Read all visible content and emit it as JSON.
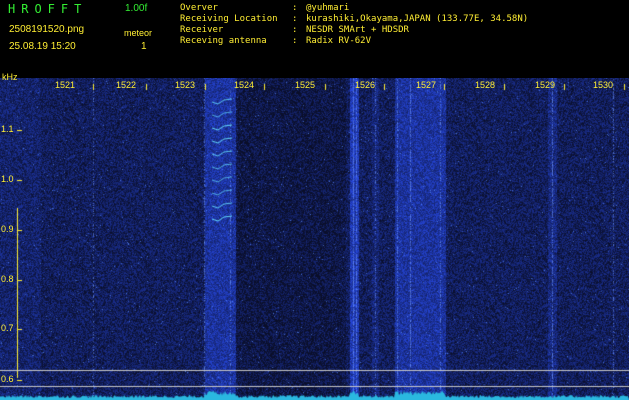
{
  "header": {
    "logo": "HROFFT",
    "version": "1.00f",
    "file_name": "2508191520.png",
    "timestamp": "25.08.19 15:20",
    "meteor_label": "meteor",
    "meteor_count": "1",
    "info": [
      {
        "key": "Overver",
        "value": "@yuhmari"
      },
      {
        "key": "Receiving Location",
        "value": "kurashiki,Okayama,JAPAN (133.77E, 34.58N)"
      },
      {
        "key": "Receiver",
        "value": "NESDR SMArt + HDSDR"
      },
      {
        "key": "Receving antenna",
        "value": "Radix RV-62V"
      }
    ]
  },
  "chart_data": {
    "type": "heatmap",
    "ylabel": "kHz",
    "y_ticks": [
      "1.1",
      "1.0",
      "0.9",
      "0.8",
      "0.7",
      "0.6"
    ],
    "x_ticks": [
      "1521",
      "1522",
      "1523",
      "1524",
      "1525",
      "1526",
      "1527",
      "1528",
      "1529",
      "1530"
    ],
    "colors": {
      "background": "#000000",
      "noise": "#1a2aa0",
      "signal": "#44ddff",
      "text": "#ffee33"
    }
  }
}
